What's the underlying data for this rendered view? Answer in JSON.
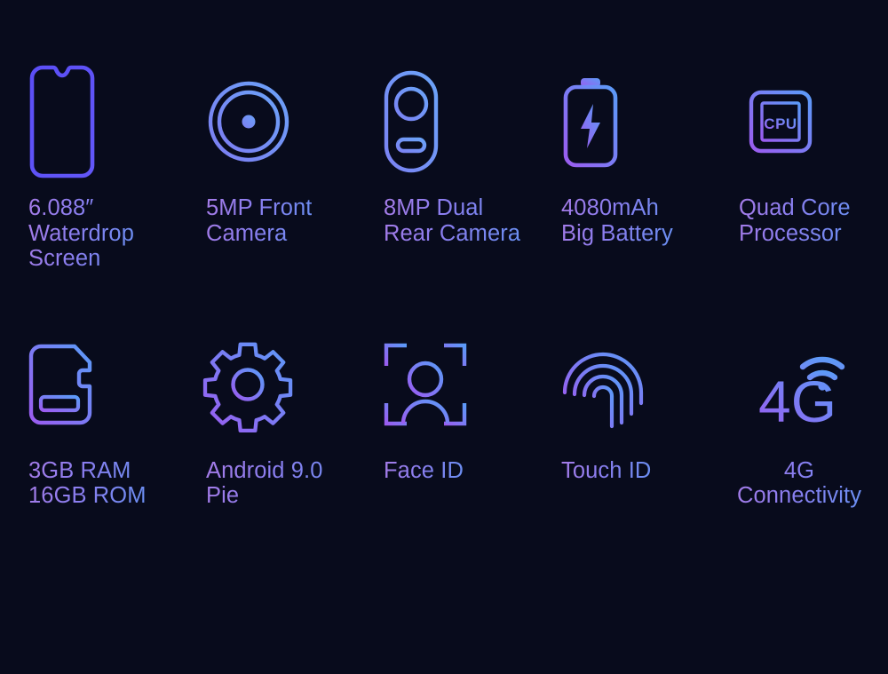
{
  "page": {
    "background_color": "#080b1c",
    "text_gradient_from": "#a57ce8",
    "text_gradient_to": "#6a8ff2",
    "icon_gradient_from": "#8b5cf6",
    "icon_gradient_to": "#5b9bf8"
  },
  "features": [
    {
      "icon": "smartphone-waterdrop-notch-icon",
      "icon_id": "phone",
      "name": "waterdrop-screen",
      "label": "6.088″\nWaterdrop\nScreen"
    },
    {
      "icon": "front-camera-lens-icon",
      "icon_id": "front-camera",
      "name": "front-camera",
      "label": "5MP Front\nCamera"
    },
    {
      "icon": "dual-rear-camera-module-icon",
      "icon_id": "rear-camera",
      "name": "rear-camera",
      "label": "8MP Dual\nRear Camera"
    },
    {
      "icon": "battery-bolt-icon",
      "icon_id": "battery",
      "name": "battery",
      "label": "4080mAh\nBig Battery"
    },
    {
      "icon": "cpu-chip-icon",
      "icon_id": "cpu",
      "name": "processor",
      "label": "Quad Core\nProcessor"
    },
    {
      "icon": "sd-memory-card-icon",
      "icon_id": "memory",
      "name": "memory",
      "label": "3GB RAM\n16GB ROM"
    },
    {
      "icon": "gear-settings-icon",
      "icon_id": "gear",
      "name": "android-version",
      "label": "Android 9.0 Pie"
    },
    {
      "icon": "face-id-scan-icon",
      "icon_id": "face-id",
      "name": "face-id",
      "label": "Face ID"
    },
    {
      "icon": "fingerprint-icon",
      "icon_id": "fingerprint",
      "name": "touch-id",
      "label": "Touch ID"
    },
    {
      "icon": "4g-signal-icon",
      "icon_id": "fourg",
      "name": "connectivity",
      "label": "4G\nConnectivity",
      "icon_text": "4G"
    }
  ]
}
